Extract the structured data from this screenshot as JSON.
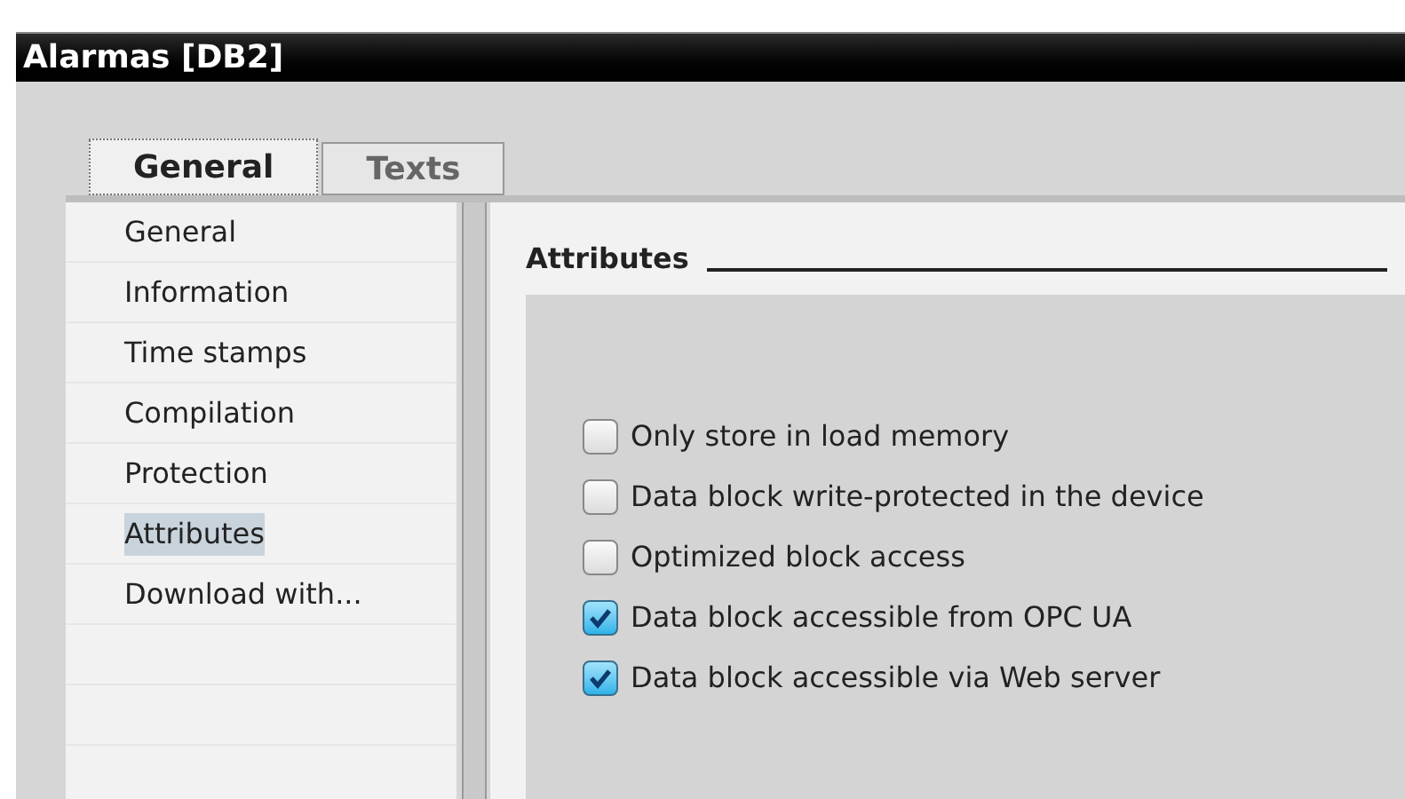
{
  "window": {
    "title": "Alarmas [DB2]"
  },
  "tabs": [
    {
      "label": "General",
      "selected": true
    },
    {
      "label": "Texts",
      "selected": false
    }
  ],
  "sidebar": {
    "items": [
      {
        "label": "General",
        "selected": false
      },
      {
        "label": "Information",
        "selected": false
      },
      {
        "label": "Time stamps",
        "selected": false
      },
      {
        "label": "Compilation",
        "selected": false
      },
      {
        "label": "Protection",
        "selected": false
      },
      {
        "label": "Attributes",
        "selected": true
      },
      {
        "label": "Download with...",
        "selected": false
      }
    ]
  },
  "section": {
    "title": "Attributes",
    "options": [
      {
        "label": "Only store in load memory",
        "checked": false
      },
      {
        "label": "Data block write-protected in the device",
        "checked": false
      },
      {
        "label": "Optimized block access",
        "checked": false
      },
      {
        "label": "Data block accessible from OPC UA",
        "checked": true
      },
      {
        "label": "Data block accessible via Web server",
        "checked": true
      }
    ]
  }
}
